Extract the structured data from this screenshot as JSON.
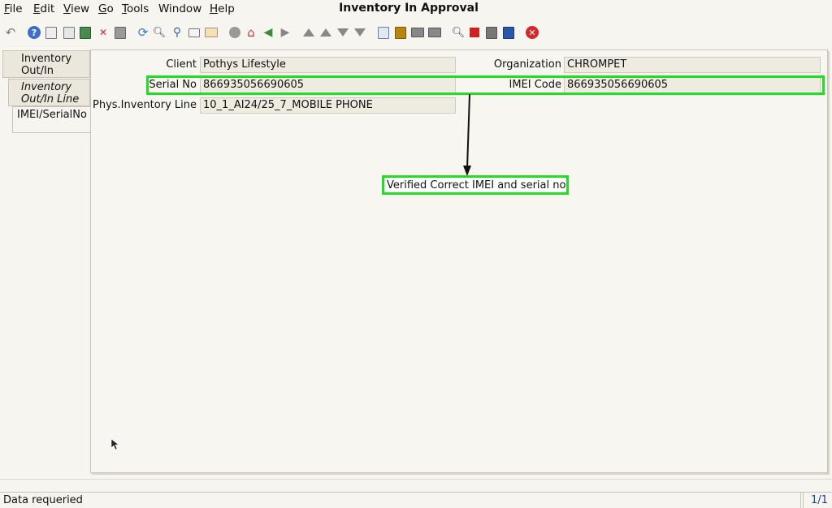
{
  "window": {
    "title": "Inventory In Approval"
  },
  "menu": [
    {
      "u": "F",
      "rest": "ile"
    },
    {
      "u": "E",
      "rest": "dit"
    },
    {
      "u": "V",
      "rest": "iew"
    },
    {
      "u": "G",
      "rest": "o"
    },
    {
      "u": "T",
      "rest": "ools"
    },
    {
      "u": "",
      "rest": "Window"
    },
    {
      "u": "H",
      "rest": "elp"
    }
  ],
  "toolbar_icons": [
    "undo-icon",
    "help-icon",
    "new-icon",
    "copy-icon",
    "save-new-icon",
    "delete-icon",
    "save-icon",
    "refresh-icon",
    "find-icon",
    "attachment-icon",
    "chat-icon",
    "grid-toggle-icon",
    "history-icon",
    "home-icon",
    "back-icon",
    "forward-icon",
    "first-record-icon",
    "previous-record-icon",
    "next-record-icon",
    "last-record-icon",
    "report-icon",
    "archive-icon",
    "print-preview-icon",
    "print-icon",
    "zoom-across-icon",
    "workflow-icon",
    "request-icon",
    "product-info-icon",
    "exit-icon"
  ],
  "tabs": [
    {
      "label_line1": "Inventory",
      "label_line2": "Out/In"
    },
    {
      "label_line1": "Inventory",
      "label_line2": "Out/In Line"
    },
    {
      "label_line1": "IMEI/SerialNo",
      "label_line2": ""
    }
  ],
  "form": {
    "client_label": "Client",
    "client_value": "Pothys Lifestyle",
    "organization_label": "Organization",
    "organization_value": "CHROMPET",
    "serial_label": "Serial No",
    "serial_value": "866935056690605",
    "imei_label": "IMEI Code",
    "imei_value": "866935056690605",
    "line_label": "Phys.Inventory Line",
    "line_value": "10_1_AI24/25_7_MOBILE PHONE"
  },
  "annotation": {
    "text": "Verified Correct IMEI and serial no",
    "highlight_color": "#22dd22"
  },
  "status": {
    "message": "Data requeried",
    "record_count": "1/1"
  }
}
